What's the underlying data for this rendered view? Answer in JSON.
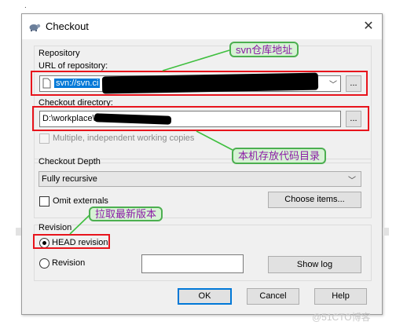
{
  "dialog": {
    "title": "Checkout",
    "close_label": "✕"
  },
  "repository": {
    "group_title": "Repository",
    "url_label": "URL of repository:",
    "url_value": "svn://svn.ci",
    "browse_label": "...",
    "dir_label": "Checkout directory:",
    "dir_value": "D:\\workplace\\",
    "dir_browse_label": "...",
    "multiple_label": "Multiple, independent working copies"
  },
  "depth": {
    "group_title": "Checkout Depth",
    "selected": "Fully recursive",
    "omit_label": "Omit externals",
    "choose_label": "Choose items..."
  },
  "revision": {
    "group_title": "Revision",
    "head_label": "HEAD revision",
    "revision_label": "Revision",
    "revision_value": "",
    "show_log_label": "Show log"
  },
  "footer": {
    "ok_label": "OK",
    "cancel_label": "Cancel",
    "help_label": "Help"
  },
  "annotations": {
    "svn_address": "svn仓库地址",
    "local_dir": "本机存放代码目录",
    "pull_latest": "拉取最新版本"
  },
  "watermark": "@51CTO博客",
  "colors": {
    "annotation_border": "#e8141c",
    "callout_fill": "#d7f2d5",
    "callout_text": "#8b1aa6",
    "arrow": "#3fbf3f",
    "selection": "#0078d7"
  }
}
